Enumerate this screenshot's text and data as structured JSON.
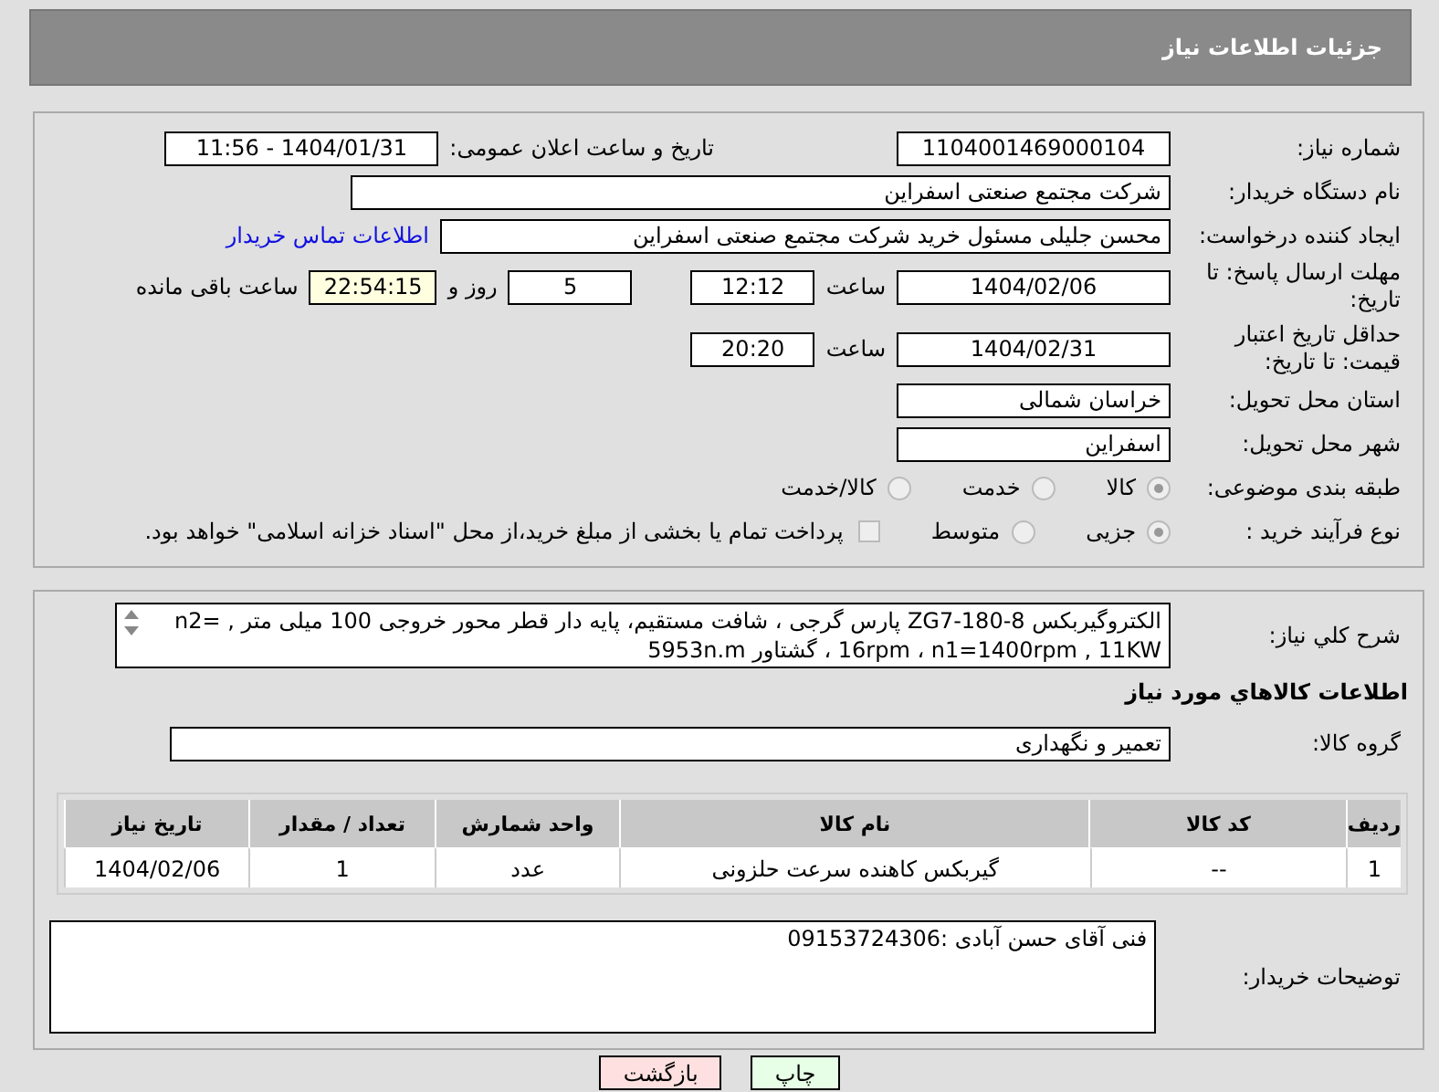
{
  "header": {
    "title": "جزئیات اطلاعات نیاز"
  },
  "details": {
    "need_number": {
      "label": "شماره نیاز:",
      "value": "1104001469000104"
    },
    "announce": {
      "label": "تاریخ و ساعت اعلان عمومی:",
      "value": "1404/01/31 - 11:56"
    },
    "buyer": {
      "label": "نام دستگاه خریدار:",
      "value": "شرکت مجتمع صنعتی اسفراین"
    },
    "creator": {
      "label": "ایجاد کننده درخواست:",
      "value": "محسن جلیلی مسئول خرید شرکت مجتمع صنعتی اسفراین",
      "link": "اطلاعات تماس خریدار"
    },
    "deadline": {
      "label": "مهلت ارسال پاسخ: تا تاریخ:",
      "date": "1404/02/06",
      "time_label": "ساعت",
      "time": "12:12",
      "days": "5",
      "days_label": "روز و",
      "remaining": "22:54:15",
      "remaining_label": "ساعت باقی مانده"
    },
    "validity": {
      "label": "حداقل تاریخ اعتبار قیمت: تا تاریخ:",
      "date": "1404/02/31",
      "time_label": "ساعت",
      "time": "20:20"
    },
    "province": {
      "label": "استان محل تحویل:",
      "value": "خراسان شمالی"
    },
    "city": {
      "label": "شهر محل تحویل:",
      "value": "اسفراین"
    },
    "category": {
      "label": "طبقه بندی موضوعی:",
      "options": [
        {
          "label": "کالا",
          "selected": true
        },
        {
          "label": "خدمت",
          "selected": false
        },
        {
          "label": "کالا/خدمت",
          "selected": false
        }
      ]
    },
    "process": {
      "label": "نوع فرآیند خرید :",
      "options": [
        {
          "label": "جزیی",
          "selected": true
        },
        {
          "label": "متوسط",
          "selected": false
        }
      ],
      "payment": {
        "checked": false,
        "label": "پرداخت تمام یا بخشی از مبلغ خرید،از محل \"اسناد خزانه اسلامی\" خواهد بود."
      }
    }
  },
  "needs": {
    "description": {
      "label": "شرح کلي نياز:",
      "value": "الکتروگیربکس ZG7-180-8  پارس گرجی ، شافت مستقیم، پایه دار قطر محور خروجی 100 میلی متر   ,   n2= 16rpm  ، n1=1400rpm , 11KW  ، گشتاور 5953n.m"
    },
    "section_title": "اطلاعات کالاهاي مورد نياز",
    "group": {
      "label": "گروه کالا:",
      "value": "تعمیر و نگهداری"
    },
    "table": {
      "columns": [
        "ردیف",
        "کد کالا",
        "نام کالا",
        "واحد شمارش",
        "تعداد / مقدار",
        "تاریخ نیاز"
      ],
      "rows": [
        [
          "1",
          "--",
          "گیربکس کاهنده سرعت حلزونی",
          "عدد",
          "1",
          "1404/02/06"
        ]
      ]
    },
    "buyer_notes": {
      "label": "توضیحات خریدار:",
      "value": "فنی آقای حسن آبادی :09153724306"
    }
  },
  "buttons": [
    {
      "label": "چاپ",
      "kind": "print"
    },
    {
      "label": "بازگشت",
      "kind": "back"
    }
  ]
}
